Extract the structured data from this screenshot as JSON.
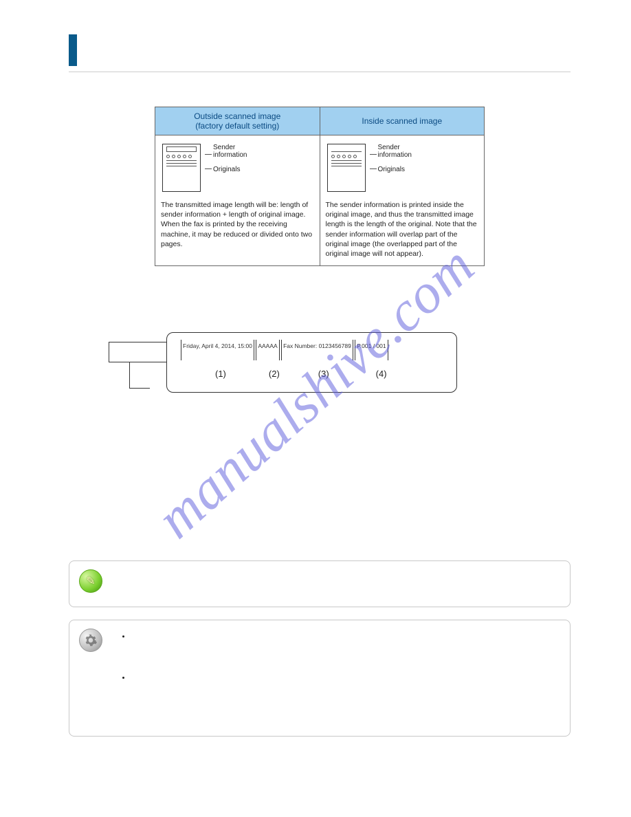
{
  "watermark": "manualshive.com",
  "table": {
    "col1_header": "Outside scanned image\n(factory default setting)",
    "col2_header": "Inside scanned image",
    "label_sender": "Sender information",
    "label_originals": "Originals",
    "col1_text": "The transmitted image length will be: length of sender information + length of original image. When the fax is printed by the receiving machine, it may be reduced or divided onto two pages.",
    "col2_text": "The sender information is printed inside the original image, and thus the transmitted image length is the length of the original. Note that the sender information will overlap part of the original image (the overlapped part of the original image will not appear)."
  },
  "fax_header": {
    "seg1": "Friday, April 4, 2014, 15:00",
    "seg2": "AAAAA",
    "seg3": "Fax Number: 0123456789",
    "seg4": "P.001 / 001",
    "n1": "(1)",
    "n2": "(2)",
    "n3": "(3)",
    "n4": "(4)"
  },
  "bullets": {
    "b1": "",
    "b2": ""
  }
}
